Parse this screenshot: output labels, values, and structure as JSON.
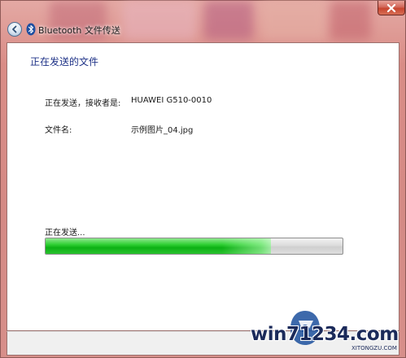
{
  "window": {
    "title": "Bluetooth 文件传送",
    "close_icon": "close-icon",
    "back_icon": "back-arrow-icon",
    "bluetooth_icon": "bluetooth-icon",
    "frame_color": "#d98c86"
  },
  "main": {
    "heading": "正在发送的文件",
    "recipient_label": "正在发送，接收者是:",
    "recipient_value": "HUAWEI G510-0010",
    "file_label": "文件名:",
    "file_value": "示例图片_04.jpg",
    "progress_label": "正在发送...",
    "progress_fraction": 0.76,
    "progress_color": "#13b81b"
  },
  "watermark": {
    "text": "win71234.com",
    "site": "XITONGZU.COM"
  }
}
